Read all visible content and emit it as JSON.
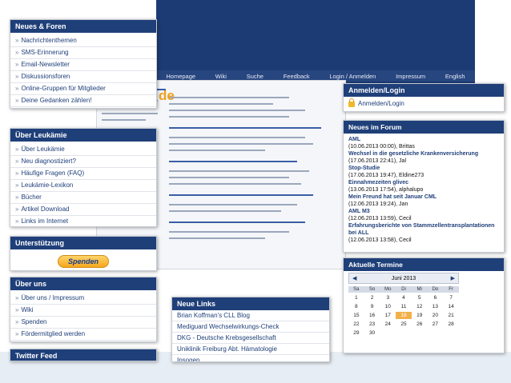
{
  "bg_site": {
    "nav": [
      "Homepage",
      "Wiki",
      "Suche",
      "Feedback",
      "Login / Anmelden",
      "Impressum",
      "English"
    ],
    "logo_text": "de"
  },
  "news_forums": {
    "title": "Neues & Foren",
    "items": [
      "Nachrichtenthemen",
      "SMS-Erinnerung",
      "Email-Newsletter",
      "Diskussionsforen",
      "Online-Gruppen für Mitglieder",
      "Deine Gedanken zählen!"
    ]
  },
  "about_leukemia": {
    "title": "Über Leukämie",
    "items": [
      "Über Leukämie",
      "Neu diagnostiziert?",
      "Häufige Fragen (FAQ)",
      "Leukämie-Lexikon",
      "Bücher",
      "Artikel Download",
      "Links im Internet"
    ]
  },
  "support": {
    "title": "Unterstützung",
    "donate_label": "Spenden"
  },
  "about_us": {
    "title": "Über uns",
    "items": [
      "Über uns / Impressum",
      "Wiki",
      "Spenden",
      "Fördermitglied werden"
    ]
  },
  "twitter": {
    "title": "Twitter Feed"
  },
  "login": {
    "title": "Anmelden/Login",
    "link": "Anmelden/Login"
  },
  "forum": {
    "title": "Neues im Forum",
    "posts": [
      {
        "topic": "AML",
        "meta": "(10.06.2013 00:00), Brittas"
      },
      {
        "topic": "Wechsel in die gesetzliche Krankenversicherung",
        "meta": "(17.06.2013 22:41), Jal"
      },
      {
        "topic": "Stop-Studie",
        "meta": "(17.06.2013 19:47), Eldine273"
      },
      {
        "topic": "Einnahmezeiten glivec",
        "meta": "(13.06.2013 17:54), alphalupo"
      },
      {
        "topic": "Mein Freund hat seit Januar CML",
        "meta": "(12.06.2013 19:24), Jan"
      },
      {
        "topic": "AML M3",
        "meta": "(12.06.2013 13:59), Cecil"
      },
      {
        "topic": "Erfahrungsberichte von Stammzellentransplantationen bei ALL",
        "meta": "(12.06.2013 13:58), Cecil"
      }
    ]
  },
  "events": {
    "title": "Aktuelle Termine",
    "month": "Juni 2013",
    "dows": [
      "Sa",
      "So",
      "Mo",
      "Di",
      "Mi",
      "Do",
      "Fr"
    ],
    "rows": [
      [
        "1",
        "2",
        "3",
        "4",
        "5",
        "6",
        "7"
      ],
      [
        "8",
        "9",
        "10",
        "11",
        "12",
        "13",
        "14"
      ],
      [
        "15",
        "16",
        "17",
        "18",
        "19",
        "20",
        "21"
      ],
      [
        "22",
        "23",
        "24",
        "25",
        "26",
        "27",
        "28"
      ],
      [
        "29",
        "30",
        "",
        "",
        "",
        "",
        ""
      ]
    ],
    "today": "18"
  },
  "new_links": {
    "title": "Neue Links",
    "items": [
      "Brian Koffman's CLL Blog",
      "Mediguard Wechselwirkungs-Check",
      "DKG - Deutsche Krebsgesellschaft",
      "Uniklinik Freiburg Abt. Hämatologie",
      "Ipsogen"
    ]
  }
}
